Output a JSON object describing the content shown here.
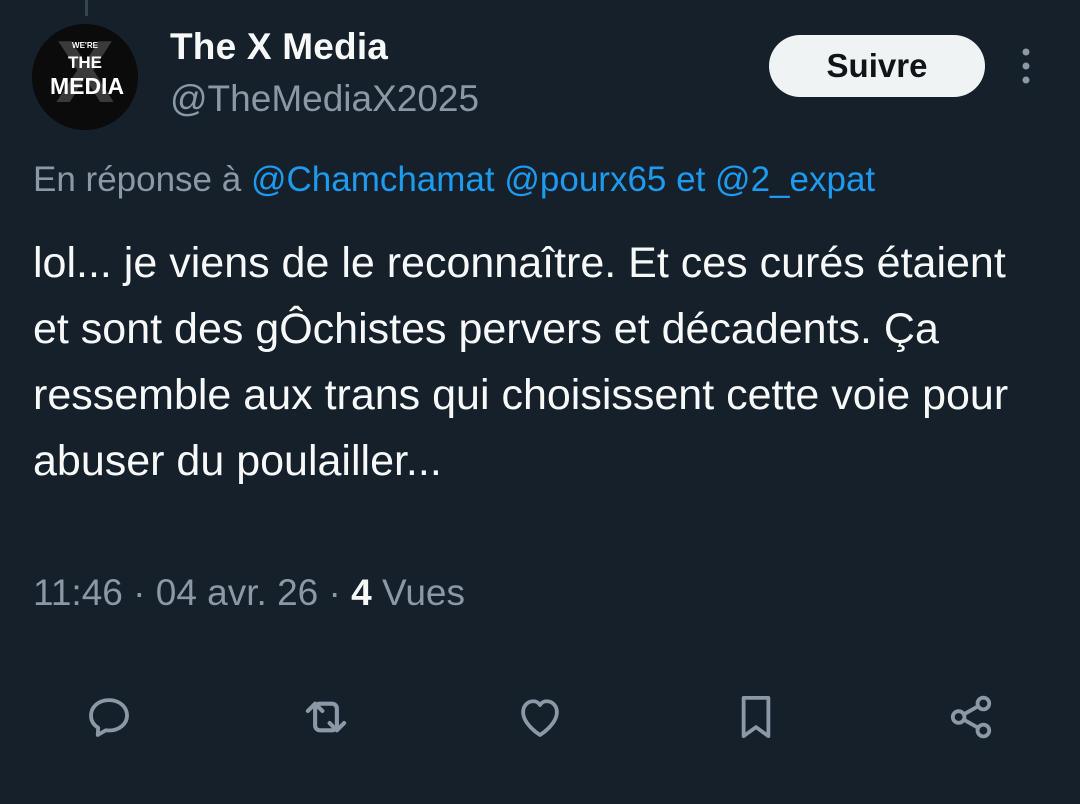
{
  "author": {
    "display_name": "The X Media",
    "handle": "@TheMediaX2025",
    "avatar_text": {
      "small": "WE'RE",
      "line1": "THE",
      "line2": "MEDIA",
      "bg_letter": "X"
    }
  },
  "follow_label": "Suivre",
  "reply_to": {
    "prefix": "En réponse à",
    "mention_1": "@Chamchamat",
    "mention_2": "@pourx65",
    "joiner": "et",
    "mention_3": "@2_expat"
  },
  "tweet_text": "lol... je viens de le reconnaître. Et ces curés étaient et sont des gÔchistes pervers et décadents. Ça ressemble aux trans qui choisissent cette voie pour abuser du poulailler...",
  "meta": {
    "time": "11:46",
    "separator": "·",
    "date": "04 avr. 26",
    "views_count": "4",
    "views_label": "Vues"
  },
  "actions": [
    {
      "name": "reply",
      "icon": "reply-icon"
    },
    {
      "name": "repost",
      "icon": "repost-icon"
    },
    {
      "name": "like",
      "icon": "heart-icon"
    },
    {
      "name": "bookmark",
      "icon": "bookmark-icon"
    },
    {
      "name": "share",
      "icon": "share-icon"
    }
  ],
  "colors": {
    "background": "#15202b",
    "primary_text": "#f7f9f9",
    "secondary_text": "#8b98a5",
    "accent": "#1d9bf0",
    "button_bg": "#eff3f4"
  }
}
